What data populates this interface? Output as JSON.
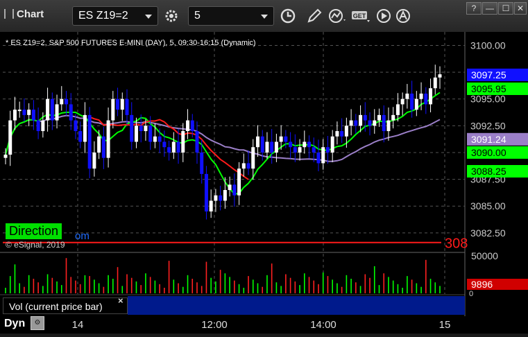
{
  "app": {
    "title": "Chart"
  },
  "toolbar": {
    "symbol": "ES Z19=2",
    "interval": "5",
    "icons": [
      "gear-icon",
      "clock-icon",
      "pencil-icon",
      "study-icon",
      "get-icon",
      "play-icon",
      "alert-icon"
    ]
  },
  "window_buttons": {
    "help": "?",
    "minimize": "—",
    "maximize": "☐",
    "close": "✕"
  },
  "chart": {
    "header": "* ES Z19=2, S&P 500 FUTURES E-MINI (DAY), 5, 09:30-16:15 (Dynamic)",
    "copyright": "© eSignal, 2019",
    "direction_label": "Direction",
    "om_text": "om",
    "price_axis_ticks": [
      "3100.00",
      "3097.50",
      "3095.00",
      "3092.50",
      "3090.00",
      "3087.50",
      "3085.00",
      "3082.50"
    ],
    "price_tags": [
      {
        "label": "3097.25",
        "value": 3097.25,
        "color": "#1010ff",
        "text": "#ffffff"
      },
      {
        "label": "3095.95",
        "value": 3095.95,
        "color": "#00ff00",
        "text": "#000000"
      },
      {
        "label": "3091.24",
        "value": 3091.24,
        "color": "#9b7fc8",
        "text": "#ffffff"
      },
      {
        "label": "3090.00",
        "value": 3090.0,
        "color": "#00ff00",
        "text": "#000000"
      },
      {
        "label": "3088.25",
        "value": 3088.25,
        "color": "#00ff00",
        "text": "#000000"
      }
    ],
    "red_level": {
      "value": 3081.6,
      "label": "308"
    },
    "volume_axis": {
      "top": "50000",
      "tag": "9896",
      "bottom": "0"
    },
    "time_axis": [
      "14",
      "12:00",
      "14:00",
      "15"
    ],
    "volume_label": "Vol (current price bar)",
    "volume_close": "×",
    "dyn_label": "Dyn",
    "colors": {
      "up": "#ffffff",
      "down": "#1010ff",
      "ma_green": "#00ff00",
      "ma_red": "#ff1a1a",
      "ma_purple": "#9b7fc8",
      "vol_red": "#ff2020",
      "vol_green": "#00ff00"
    }
  },
  "chart_data": {
    "type": "candlestick",
    "ylim": [
      3081.0,
      3101.0
    ],
    "close": [
      3089.8,
      3093.0,
      3094.0,
      3094.0,
      3093.5,
      3094.0,
      3093.0,
      3092.0,
      3093.0,
      3095.0,
      3093.0,
      3094.5,
      3095.0,
      3094.5,
      3093.0,
      3092.0,
      3091.0,
      3093.5,
      3088.5,
      3090.0,
      3091.5,
      3089.5,
      3093.0,
      3095.0,
      3094.0,
      3095.0,
      3093.5,
      3091.0,
      3092.5,
      3092.0,
      3092.5,
      3091.0,
      3091.5,
      3091.0,
      3090.5,
      3090.0,
      3091.0,
      3090.0,
      3092.0,
      3093.0,
      3092.0,
      3090.0,
      3088.0,
      3084.5,
      3085.5,
      3086.0,
      3085.5,
      3086.5,
      3087.0,
      3086.0,
      3088.5,
      3089.0,
      3088.5,
      3090.5,
      3091.5,
      3090.0,
      3091.0,
      3090.0,
      3091.0,
      3091.5,
      3091.0,
      3090.5,
      3090.0,
      3090.5,
      3091.0,
      3090.5,
      3090.0,
      3089.0,
      3090.5,
      3090.0,
      3091.5,
      3092.0,
      3091.5,
      3092.5,
      3093.0,
      3092.5,
      3093.5,
      3093.0,
      3092.5,
      3093.0,
      3093.5,
      3092.0,
      3093.0,
      3093.5,
      3094.5,
      3095.0,
      3095.5,
      3094.0,
      3095.0,
      3095.5,
      3094.5,
      3096.0,
      3097.0,
      3097.3
    ]
  }
}
